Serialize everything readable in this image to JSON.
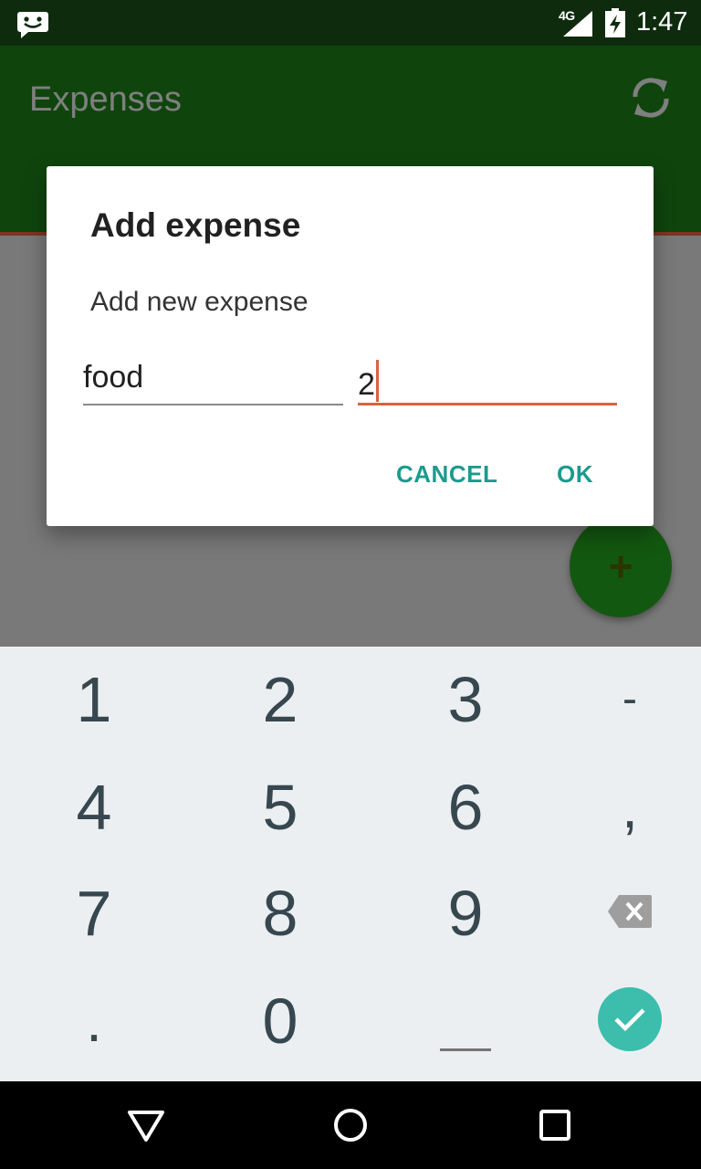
{
  "status_bar": {
    "network": "4G",
    "time": "1:47",
    "icons": [
      "message-icon",
      "signal-icon",
      "battery-charging-icon"
    ]
  },
  "app_bar": {
    "title": "Expenses",
    "refresh_icon": "refresh-icon"
  },
  "fab": {
    "icon": "plus-icon",
    "label": "+"
  },
  "dialog": {
    "title": "Add expense",
    "message": "Add new expense",
    "name_value": "food",
    "amount_value": "2",
    "cancel_label": "CANCEL",
    "ok_label": "OK"
  },
  "keyboard": {
    "keys": [
      "1",
      "2",
      "3",
      "-",
      "4",
      "5",
      "6",
      ",",
      "7",
      "8",
      "9",
      ".",
      "0"
    ],
    "backspace_icon": "backspace-icon",
    "space_icon": "space-icon",
    "enter_icon": "check-icon"
  },
  "nav_bar": {
    "icons": [
      "back-icon",
      "home-icon",
      "recents-icon"
    ]
  },
  "colors": {
    "primary": "#1f8a1a",
    "status_bar": "#0f2b0e",
    "accent": "#1c9a8e",
    "field_focus": "#d9623f",
    "fab": "#27b020"
  }
}
